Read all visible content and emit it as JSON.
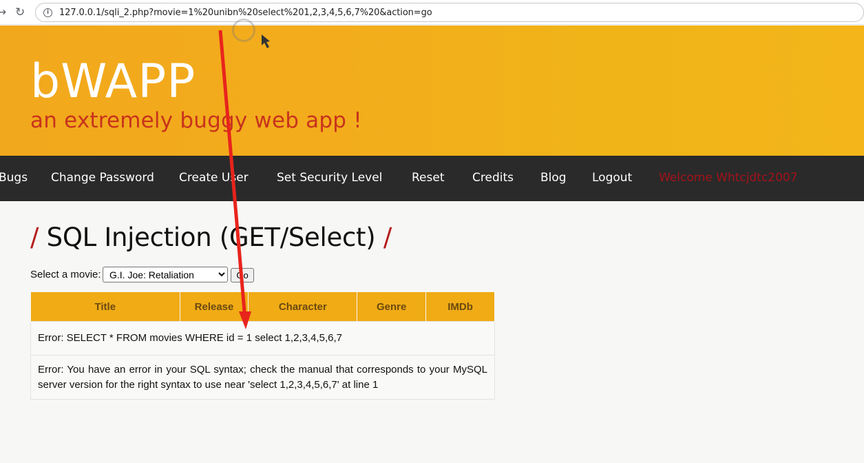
{
  "browser": {
    "url": "127.0.0.1/sqli_2.php?movie=1%20unibn%20select%201,2,3,4,5,6,7%20&action=go",
    "back_icon": "arrow-back-icon",
    "reload_icon": "reload-icon",
    "info_icon": "info-icon"
  },
  "header": {
    "logo": "bWAPP",
    "tagline": "an extremely buggy web app !"
  },
  "menu": {
    "items": [
      "Bugs",
      "Change Password",
      "Create User",
      "Set Security Level",
      "Reset",
      "Credits",
      "Blog",
      "Logout"
    ],
    "welcome": "Welcome Whtcjdtc2007"
  },
  "page": {
    "title": "SQL Injection (GET/Select)",
    "slash": "/"
  },
  "form": {
    "label": "Select a movie:",
    "selected_movie": "G.I. Joe: Retaliation",
    "go_label": "Go"
  },
  "table": {
    "headers": [
      "Title",
      "Release",
      "Character",
      "Genre",
      "IMDb"
    ],
    "row1": "Error: SELECT * FROM movies WHERE id = 1 select 1,2,3,4,5,6,7",
    "row2": "Error: You have an error in your SQL syntax; check the manual that corresponds to your MySQL server version for the right syntax to use near 'select 1,2,3,4,5,6,7' at line 1"
  },
  "colors": {
    "header_orange": "#f2a81c",
    "tagline_red": "#c8331c",
    "menu_dark": "#2a2a2a",
    "welcome_red": "#a3121a",
    "annotation_red": "#e8241c"
  }
}
